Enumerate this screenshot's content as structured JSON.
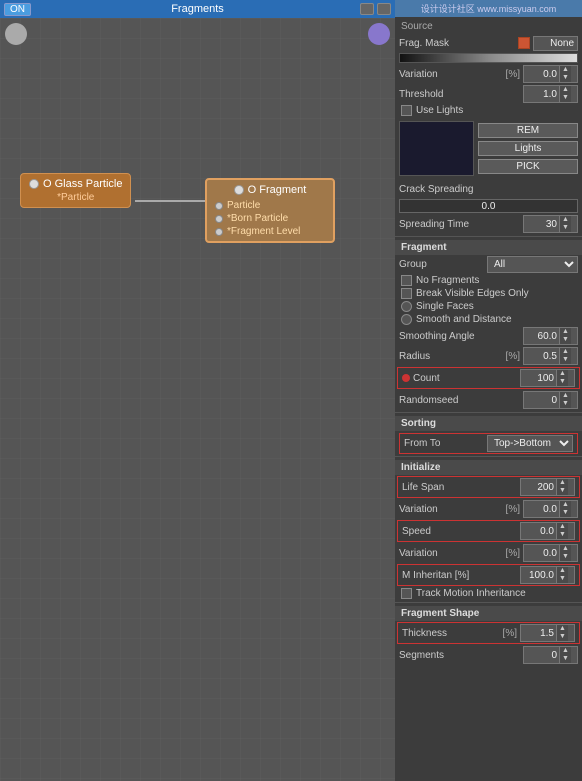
{
  "window": {
    "title": "Fragments"
  },
  "leftPanel": {
    "onBtn": "ON",
    "nodeGlass": {
      "label": "O Glass Particle",
      "sub": "*Particle"
    },
    "nodeFragment": {
      "label": "O Fragment",
      "ports": [
        "Particle",
        "*Born Particle",
        "*Fragment Level"
      ]
    }
  },
  "rightPanel": {
    "watermark": "设计设计社区 www.missyuan.com",
    "source": {
      "label": "Source",
      "fragMaskLabel": "Frag. Mask",
      "fragMaskValue": "None"
    },
    "variation": {
      "label": "Variation",
      "pct": "[%]",
      "value": "0.0"
    },
    "threshold": {
      "label": "Threshold",
      "value": "1.0"
    },
    "useLightsLabel": "Use Lights",
    "lights": {
      "remLabel": "REM",
      "lightsLabel": "Lights",
      "pickLabel": "PICK"
    },
    "crackSpreading": {
      "label": "Crack Spreading",
      "value": "0.0"
    },
    "spreadingTime": {
      "label": "Spreading Time",
      "value": "30"
    },
    "fragment": {
      "sectionLabel": "Fragment",
      "groupLabel": "Group",
      "groupValue": "All",
      "noFragmentsLabel": "No Fragments",
      "breakVisibleLabel": "Break Visible Edges Only",
      "singleFacesLabel": "Single Faces",
      "smoothDistLabel": "Smooth and Distance",
      "smoothingAngleLabel": "Smoothing Angle",
      "smoothingAngleValue": "60.0",
      "radiusLabel": "Radius",
      "radiusPct": "[%]",
      "radiusValue": "0.5"
    },
    "count": {
      "label": "Count",
      "value": "100"
    },
    "randomseed": {
      "label": "Randomseed",
      "value": "0"
    },
    "sorting": {
      "sectionLabel": "Sorting",
      "fromToLabel": "From To",
      "fromToValue": "Top->Bottom"
    },
    "initialize": {
      "sectionLabel": "Initialize",
      "lifeSpanLabel": "Life Span",
      "lifeSpanValue": "200",
      "variationLabel": "Variation",
      "variationPct": "[%]",
      "variationValue": "0.0",
      "speedLabel": "Speed",
      "speedValue": "0.0",
      "variation2Label": "Variation",
      "variation2Pct": "[%]",
      "variation2Value": "0.0",
      "mInheritLabel": "M Inheritan [%]",
      "mInheritValue": "100.0",
      "trackMotionLabel": "Track Motion Inheritance"
    },
    "fragmentShape": {
      "sectionLabel": "Fragment Shape",
      "thicknessLabel": "Thickness",
      "thicknessPct": "[%]",
      "thicknessValue": "1.5",
      "segmentsLabel": "Segments",
      "segmentsValue": "0"
    }
  }
}
